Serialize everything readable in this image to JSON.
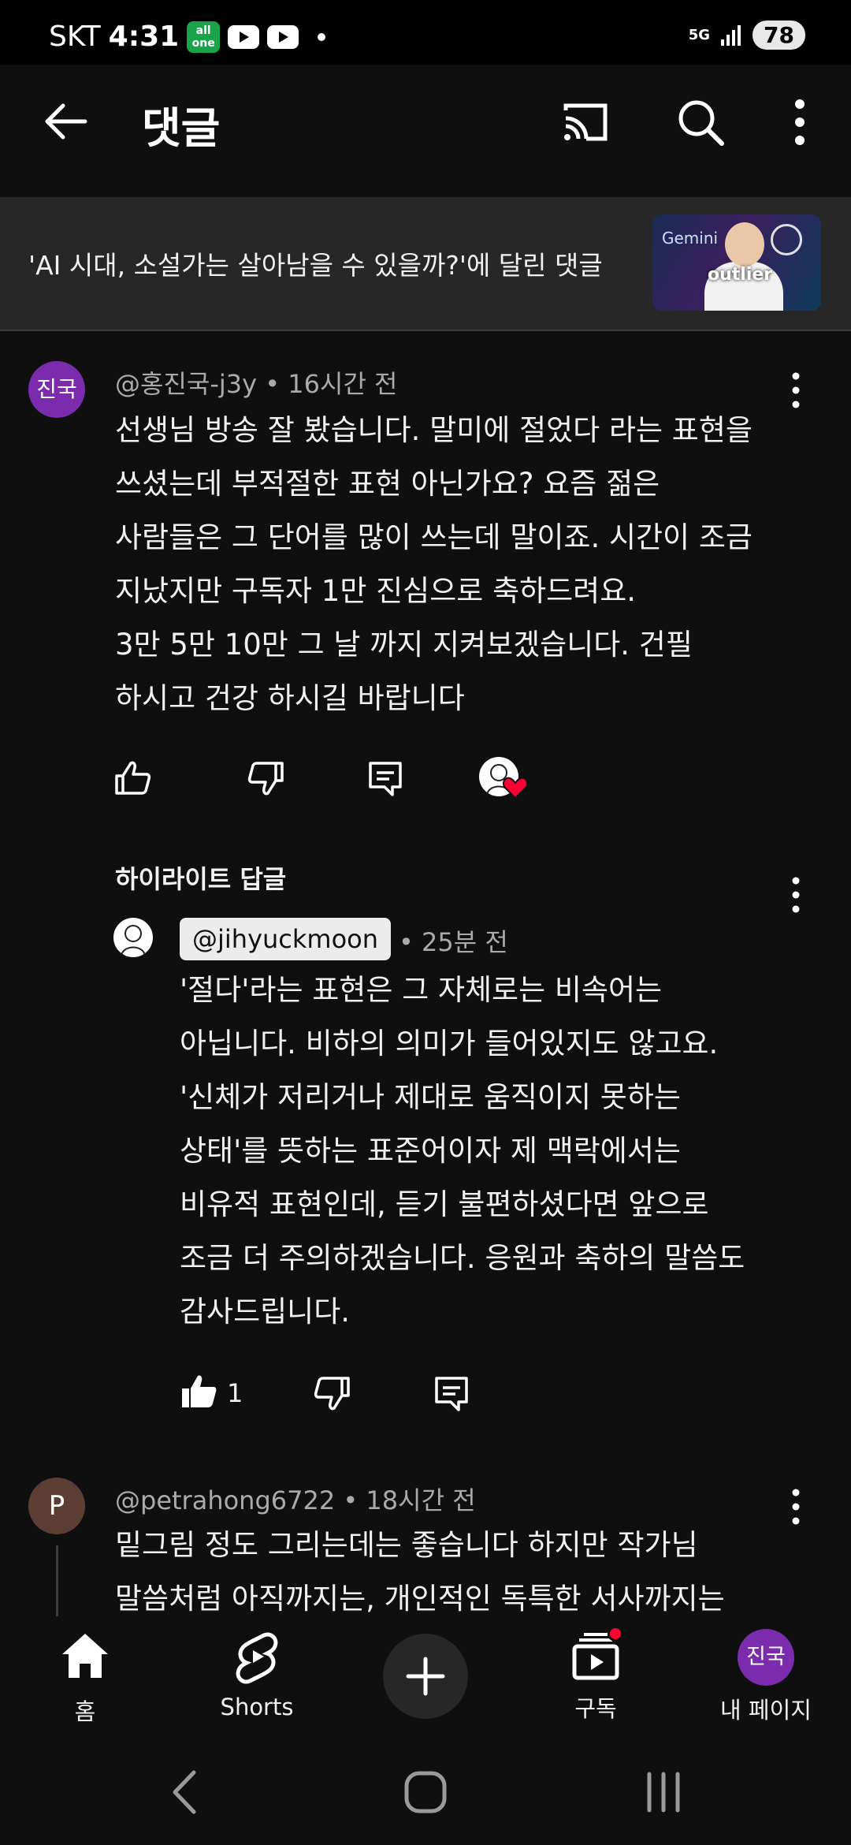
{
  "status_bar": {
    "carrier": "SKT",
    "time": "4:31",
    "app_badge": "all one",
    "network": "5G",
    "battery": "78"
  },
  "header": {
    "title": "댓글"
  },
  "video": {
    "context_text": "'AI 시대, 소설가는 살아남을 수 있을까?'에 달린 댓글",
    "thumbnail_word": "Gemini",
    "thumbnail_overlay": "outlier"
  },
  "comments": [
    {
      "avatar_text": "진국",
      "author": "@홍진국-j3y",
      "time": "16시간 전",
      "text": "선생님 방송 잘 봤습니다. 말미에  절었다 라는 표현을\n쓰셨는데 부적절한 표현 아닌가요? 요즘 젊은\n사람들은 그 단어를 많이 쓰는데 말이죠. 시간이 조금\n지났지만 구독자 1만 진심으로 축하드려요.\n3만 5만 10만 그 날 까지 지켜보겠습니다. 건필\n하시고 건강 하시길 바랍니다"
    },
    {
      "avatar_text": "P",
      "author": "@petrahong6722",
      "time": "18시간 전",
      "text": "밑그림 정도 그리는데는 좋습니다 하지만 작가님\n말씀처럼 아직까지는, 개인적인 독특한 서사까지는"
    }
  ],
  "highlight_reply": {
    "section_label": "하이라이트 답글",
    "author": "@jihyuckmoon",
    "time": "25분 전",
    "text": "'절다'라는 표현은 그 자체로는 비속어는\n아닙니다. 비하의 의미가 들어있지도 않고요.\n'신체가 저리거나 제대로 움직이지 못하는\n상태'를 뜻하는 표준어이자 제 맥락에서는\n비유적 표현인데, 듣기 불편하셨다면 앞으로\n조금 더 주의하겠습니다. 응원과 축하의 말씀도\n감사드립니다.",
    "like_count": "1"
  },
  "bottom_nav": {
    "home": "홈",
    "shorts": "Shorts",
    "subscriptions": "구독",
    "my_page": "내 페이지",
    "my_avatar_text": "진국"
  },
  "colors": {
    "background": "#0f0f0f",
    "surface": "#272727",
    "avatar_purple": "#7b2cad",
    "heart_red": "#ff0033"
  }
}
